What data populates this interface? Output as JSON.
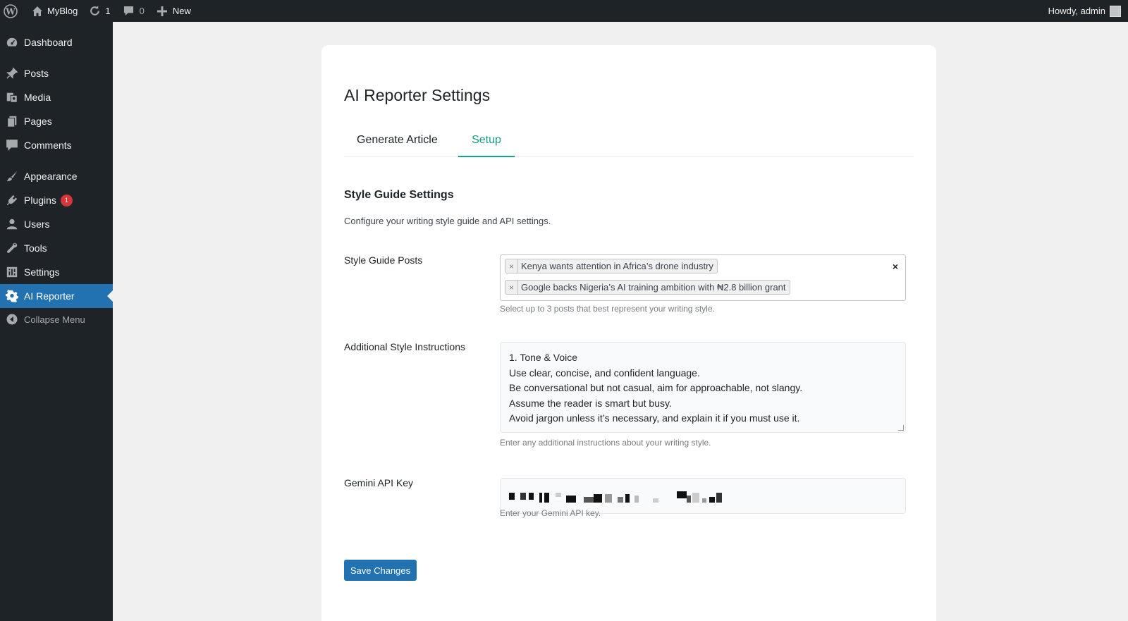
{
  "adminbar": {
    "site_name": "MyBlog",
    "updates_count": "1",
    "comments_count": "0",
    "new_label": "New",
    "howdy": "Howdy, admin",
    "icons": [
      "wordpress-icon",
      "home-icon",
      "refresh-icon",
      "comment-icon",
      "plus-icon",
      "avatar"
    ]
  },
  "sidebar": {
    "items": [
      {
        "label": "Dashboard",
        "icon": "dashboard-icon"
      },
      {
        "label": "Posts",
        "icon": "pin-icon"
      },
      {
        "label": "Media",
        "icon": "media-icon"
      },
      {
        "label": "Pages",
        "icon": "pages-icon"
      },
      {
        "label": "Comments",
        "icon": "comment-icon"
      },
      {
        "label": "Appearance",
        "icon": "brush-icon"
      },
      {
        "label": "Plugins",
        "icon": "plugin-icon",
        "badge": "1"
      },
      {
        "label": "Users",
        "icon": "user-icon"
      },
      {
        "label": "Tools",
        "icon": "wrench-icon"
      },
      {
        "label": "Settings",
        "icon": "settings-icon"
      },
      {
        "label": "AI Reporter",
        "icon": "gear-icon",
        "active": true
      },
      {
        "label": "Collapse Menu",
        "icon": "collapse-icon"
      }
    ]
  },
  "main": {
    "title": "AI Reporter Settings",
    "tabs": [
      {
        "label": "Generate Article",
        "active": false
      },
      {
        "label": "Setup",
        "active": true
      }
    ],
    "section_title": "Style Guide Settings",
    "section_desc": "Configure your writing style guide and API settings.",
    "fields": {
      "style_posts": {
        "label": "Style Guide Posts",
        "tags": [
          "Kenya wants attention in Africa’s drone industry",
          "Google backs Nigeria’s AI training ambition with ₦2.8 billion grant"
        ],
        "clear": "×",
        "remove": "×",
        "help": "Select up to 3 posts that best represent your writing style."
      },
      "instructions": {
        "label": "Additional Style Instructions",
        "lines": [
          "1. Tone & Voice",
          "Use clear, concise, and confident language.",
          "Be conversational but not casual, aim for approachable, not slangy.",
          "Assume the reader is smart but busy.",
          "Avoid jargon unless it’s necessary, and explain it if you must use it."
        ],
        "help": "Enter any additional instructions about your writing style."
      },
      "api_key": {
        "label": "Gemini API Key",
        "help": "Enter your Gemini API key."
      }
    },
    "save_label": "Save Changes"
  },
  "colors": {
    "admin_dark": "#1d2327",
    "accent_blue": "#2271b1",
    "tab_green": "#16a085",
    "badge_red": "#d63638"
  }
}
